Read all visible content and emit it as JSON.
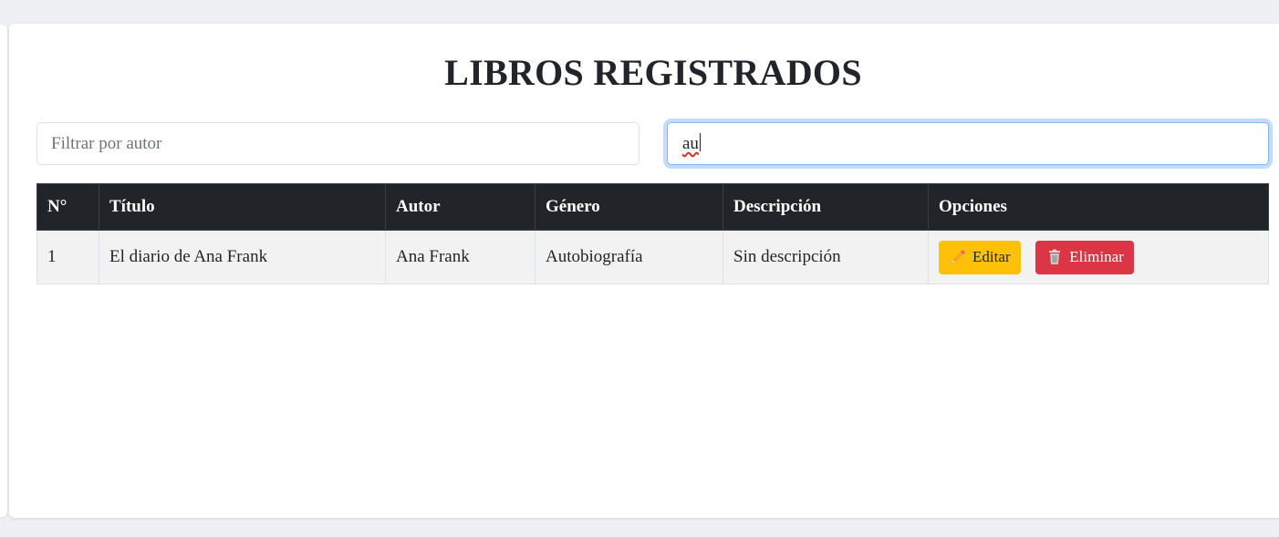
{
  "page": {
    "title": "LIBROS REGISTRADOS"
  },
  "filters": {
    "author_placeholder": "Filtrar por autor",
    "second_value": "au"
  },
  "table": {
    "headers": [
      "N°",
      "Título",
      "Autor",
      "Género",
      "Descripción",
      "Opciones"
    ],
    "rows": [
      {
        "number": "1",
        "title": "El diario de Ana Frank",
        "author": "Ana Frank",
        "genre": "Autobiografía",
        "description": "Sin descripción",
        "edit_label": "Editar",
        "delete_label": "Eliminar"
      }
    ]
  },
  "icons": {
    "edit": "pencil-icon",
    "delete": "trash-icon"
  },
  "colors": {
    "header_bg": "#212529",
    "edit_button": "#ffc107",
    "delete_button": "#dc3545",
    "focus_ring": "#86b7fe"
  }
}
